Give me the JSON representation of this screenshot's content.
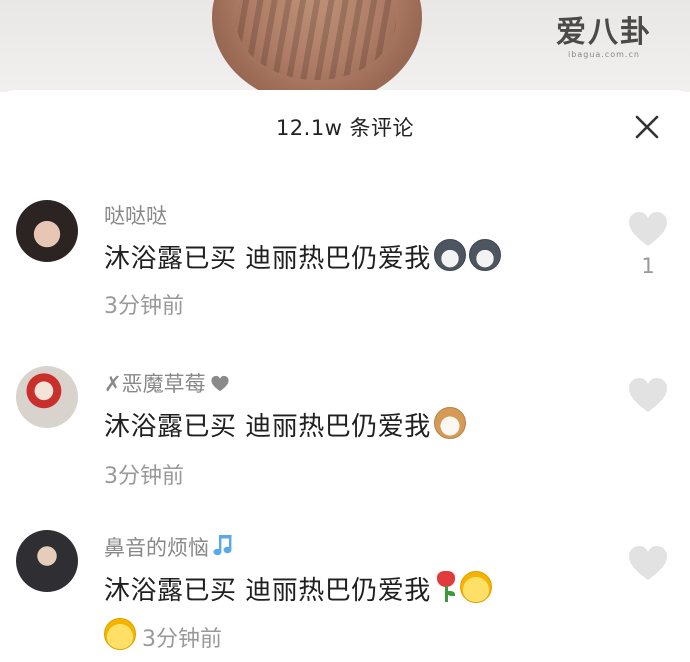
{
  "watermark": {
    "logo": "爱八卦",
    "site": "ibagua.com.cn"
  },
  "header": {
    "title": "12.1w 条评论"
  },
  "comments": [
    {
      "username": "哒哒哒",
      "text": "沐浴露已买 迪丽热巴仍爱我",
      "time": "3分钟前",
      "like_count": "1",
      "emojis": [
        "husky-icon",
        "husky-icon"
      ]
    },
    {
      "username": "✗恶魔草莓",
      "text": "沐浴露已买 迪丽热巴仍爱我",
      "time": "3分钟前",
      "like_count": "",
      "emojis": [
        "cat-icon"
      ]
    },
    {
      "username": "鼻音的烦恼",
      "text": "沐浴露已买 迪丽热巴仍爱我",
      "time": "3分钟前",
      "like_count": "",
      "emojis": [
        "rose-icon",
        "laughing-face-icon",
        "laughing-face-icon"
      ]
    }
  ],
  "colors": {
    "username": "#888888",
    "text": "#1f1f1f",
    "meta": "#999999",
    "heart": "#e2e2e2",
    "note": "#5aa8e8"
  }
}
